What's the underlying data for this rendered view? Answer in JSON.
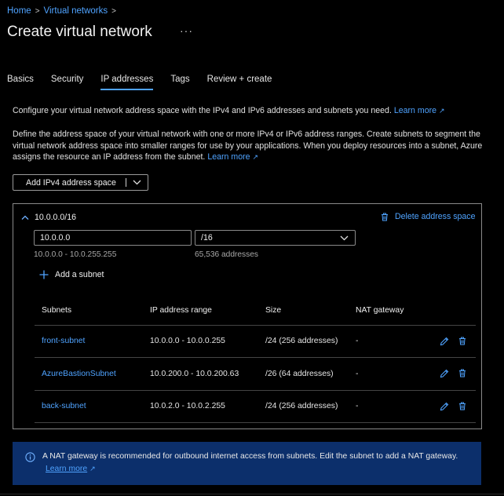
{
  "breadcrumb": {
    "home": "Home",
    "section": "Virtual networks",
    "sep": ">"
  },
  "page": {
    "title": "Create virtual network",
    "more": "···"
  },
  "tabs": [
    {
      "label": "Basics",
      "active": false
    },
    {
      "label": "Security",
      "active": false
    },
    {
      "label": "IP addresses",
      "active": true
    },
    {
      "label": "Tags",
      "active": false
    },
    {
      "label": "Review + create",
      "active": false
    }
  ],
  "intro": {
    "text": "Configure your virtual network address space with the IPv4 and IPv6 addresses and subnets you need.",
    "link": "Learn more"
  },
  "define": {
    "text": "Define the address space of your virtual network with one or more IPv4 or IPv6 address ranges. Create subnets to segment the virtual network address space into smaller ranges for use by your applications. When you deploy resources into a subnet, Azure assigns the resource an IP address from the subnet.",
    "link": "Learn more"
  },
  "add_space_button": "Add IPv4 address space",
  "address_space": {
    "cidr": "10.0.0.0/16",
    "delete_label": "Delete address space",
    "start_address": "10.0.0.0",
    "range": "10.0.0.0 - 10.0.255.255",
    "prefix": "/16",
    "address_count": "65,536 addresses",
    "add_subnet": "Add a subnet"
  },
  "subnets_table": {
    "headers": [
      "Subnets",
      "IP address range",
      "Size",
      "NAT gateway"
    ],
    "rows": [
      {
        "name": "front-subnet",
        "range": "10.0.0.0 - 10.0.0.255",
        "size": "/24 (256 addresses)",
        "nat": "-"
      },
      {
        "name": "AzureBastionSubnet",
        "range": "10.0.200.0 - 10.0.200.63",
        "size": "/26 (64 addresses)",
        "nat": "-"
      },
      {
        "name": "back-subnet",
        "range": "10.0.2.0 - 10.0.2.255",
        "size": "/24 (256 addresses)",
        "nat": "-"
      }
    ]
  },
  "info_banner": {
    "text": "A NAT gateway is recommended for outbound internet access from subnets. Edit the subnet to add a NAT gateway.",
    "link": "Learn more"
  },
  "icons": {
    "chevron_right": "chevron-right-icon",
    "external": "external-link-icon",
    "chevron_down": "chevron-down-icon",
    "chevron_up": "chevron-up-icon",
    "trash": "trash-icon",
    "plus": "plus-icon",
    "edit": "pencil-icon",
    "info": "info-icon"
  },
  "colors": {
    "accent": "#4fa3ff",
    "background": "#000000",
    "banner": "#0c2f6b",
    "border": "#8a8a8a"
  }
}
